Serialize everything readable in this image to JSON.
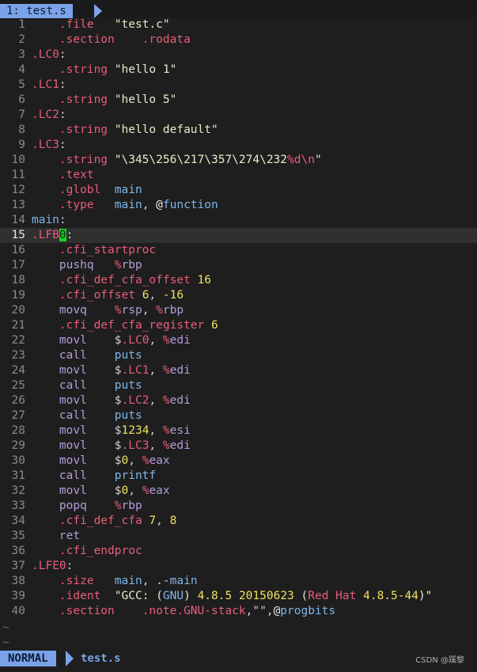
{
  "tab": {
    "label": "1: test.s"
  },
  "cursor": {
    "line": 15,
    "col": 5
  },
  "lines": [
    [
      [
        "t-plain",
        "    "
      ],
      [
        "t-dir",
        ".file"
      ],
      [
        "t-plain",
        "   "
      ],
      [
        "t-str",
        "\"test.c\""
      ]
    ],
    [
      [
        "t-plain",
        "    "
      ],
      [
        "t-dir",
        ".section"
      ],
      [
        "t-plain",
        "    "
      ],
      [
        "t-dir",
        ".rodata"
      ]
    ],
    [
      [
        "t-lbl",
        ".LC0"
      ],
      [
        "t-plain",
        ":"
      ]
    ],
    [
      [
        "t-plain",
        "    "
      ],
      [
        "t-dir",
        ".string"
      ],
      [
        "t-plain",
        " "
      ],
      [
        "t-str",
        "\"hello 1\""
      ]
    ],
    [
      [
        "t-lbl",
        ".LC1"
      ],
      [
        "t-plain",
        ":"
      ]
    ],
    [
      [
        "t-plain",
        "    "
      ],
      [
        "t-dir",
        ".string"
      ],
      [
        "t-plain",
        " "
      ],
      [
        "t-str",
        "\"hello 5\""
      ]
    ],
    [
      [
        "t-lbl",
        ".LC2"
      ],
      [
        "t-plain",
        ":"
      ]
    ],
    [
      [
        "t-plain",
        "    "
      ],
      [
        "t-dir",
        ".string"
      ],
      [
        "t-plain",
        " "
      ],
      [
        "t-str",
        "\"hello default\""
      ]
    ],
    [
      [
        "t-lbl",
        ".LC3"
      ],
      [
        "t-plain",
        ":"
      ]
    ],
    [
      [
        "t-plain",
        "    "
      ],
      [
        "t-dir",
        ".string"
      ],
      [
        "t-plain",
        " "
      ],
      [
        "t-str",
        "\"\\345\\256\\217\\357\\274\\232"
      ],
      [
        "t-esc",
        "%d"
      ],
      [
        "t-esc",
        "\\n"
      ],
      [
        "t-str",
        "\""
      ]
    ],
    [
      [
        "t-plain",
        "    "
      ],
      [
        "t-dir",
        ".text"
      ]
    ],
    [
      [
        "t-plain",
        "    "
      ],
      [
        "t-dir",
        ".globl"
      ],
      [
        "t-plain",
        "  "
      ],
      [
        "t-fn",
        "main"
      ]
    ],
    [
      [
        "t-plain",
        "    "
      ],
      [
        "t-dir",
        ".type"
      ],
      [
        "t-plain",
        "   "
      ],
      [
        "t-fn",
        "main"
      ],
      [
        "t-plain",
        ", "
      ],
      [
        "t-at",
        "@"
      ],
      [
        "t-fn",
        "function"
      ]
    ],
    [
      [
        "t-fn",
        "main"
      ],
      [
        "t-plain",
        ":"
      ]
    ],
    [
      [
        "t-lbl",
        ".LFB"
      ],
      [
        "t-cursor",
        "0"
      ],
      [
        "t-plain",
        ":"
      ]
    ],
    [
      [
        "t-plain",
        "    "
      ],
      [
        "t-dir",
        ".cfi_startproc"
      ]
    ],
    [
      [
        "t-plain",
        "    "
      ],
      [
        "t-ins",
        "pushq"
      ],
      [
        "t-plain",
        "   "
      ],
      [
        "t-reg",
        "%"
      ],
      [
        "t-ins",
        "rbp"
      ]
    ],
    [
      [
        "t-plain",
        "    "
      ],
      [
        "t-dir",
        ".cfi_def_cfa_offset"
      ],
      [
        "t-plain",
        " "
      ],
      [
        "t-num",
        "16"
      ]
    ],
    [
      [
        "t-plain",
        "    "
      ],
      [
        "t-dir",
        ".cfi_offset"
      ],
      [
        "t-plain",
        " "
      ],
      [
        "t-num",
        "6"
      ],
      [
        "t-plain",
        ", "
      ],
      [
        "t-num",
        "-16"
      ]
    ],
    [
      [
        "t-plain",
        "    "
      ],
      [
        "t-ins",
        "movq"
      ],
      [
        "t-plain",
        "    "
      ],
      [
        "t-reg",
        "%"
      ],
      [
        "t-ins",
        "rsp"
      ],
      [
        "t-plain",
        ", "
      ],
      [
        "t-reg",
        "%"
      ],
      [
        "t-ins",
        "rbp"
      ]
    ],
    [
      [
        "t-plain",
        "    "
      ],
      [
        "t-dir",
        ".cfi_def_cfa_register"
      ],
      [
        "t-plain",
        " "
      ],
      [
        "t-num",
        "6"
      ]
    ],
    [
      [
        "t-plain",
        "    "
      ],
      [
        "t-ins",
        "movl"
      ],
      [
        "t-plain",
        "    "
      ],
      [
        "t-plain",
        "$"
      ],
      [
        "t-lbl",
        ".LC0"
      ],
      [
        "t-plain",
        ", "
      ],
      [
        "t-reg",
        "%"
      ],
      [
        "t-ins",
        "edi"
      ]
    ],
    [
      [
        "t-plain",
        "    "
      ],
      [
        "t-ins",
        "call"
      ],
      [
        "t-plain",
        "    "
      ],
      [
        "t-fn",
        "puts"
      ]
    ],
    [
      [
        "t-plain",
        "    "
      ],
      [
        "t-ins",
        "movl"
      ],
      [
        "t-plain",
        "    "
      ],
      [
        "t-plain",
        "$"
      ],
      [
        "t-lbl",
        ".LC1"
      ],
      [
        "t-plain",
        ", "
      ],
      [
        "t-reg",
        "%"
      ],
      [
        "t-ins",
        "edi"
      ]
    ],
    [
      [
        "t-plain",
        "    "
      ],
      [
        "t-ins",
        "call"
      ],
      [
        "t-plain",
        "    "
      ],
      [
        "t-fn",
        "puts"
      ]
    ],
    [
      [
        "t-plain",
        "    "
      ],
      [
        "t-ins",
        "movl"
      ],
      [
        "t-plain",
        "    "
      ],
      [
        "t-plain",
        "$"
      ],
      [
        "t-lbl",
        ".LC2"
      ],
      [
        "t-plain",
        ", "
      ],
      [
        "t-reg",
        "%"
      ],
      [
        "t-ins",
        "edi"
      ]
    ],
    [
      [
        "t-plain",
        "    "
      ],
      [
        "t-ins",
        "call"
      ],
      [
        "t-plain",
        "    "
      ],
      [
        "t-fn",
        "puts"
      ]
    ],
    [
      [
        "t-plain",
        "    "
      ],
      [
        "t-ins",
        "movl"
      ],
      [
        "t-plain",
        "    "
      ],
      [
        "t-plain",
        "$"
      ],
      [
        "t-num",
        "1234"
      ],
      [
        "t-plain",
        ", "
      ],
      [
        "t-reg",
        "%"
      ],
      [
        "t-ins",
        "esi"
      ]
    ],
    [
      [
        "t-plain",
        "    "
      ],
      [
        "t-ins",
        "movl"
      ],
      [
        "t-plain",
        "    "
      ],
      [
        "t-plain",
        "$"
      ],
      [
        "t-lbl",
        ".LC3"
      ],
      [
        "t-plain",
        ", "
      ],
      [
        "t-reg",
        "%"
      ],
      [
        "t-ins",
        "edi"
      ]
    ],
    [
      [
        "t-plain",
        "    "
      ],
      [
        "t-ins",
        "movl"
      ],
      [
        "t-plain",
        "    "
      ],
      [
        "t-plain",
        "$"
      ],
      [
        "t-num",
        "0"
      ],
      [
        "t-plain",
        ", "
      ],
      [
        "t-reg",
        "%"
      ],
      [
        "t-ins",
        "eax"
      ]
    ],
    [
      [
        "t-plain",
        "    "
      ],
      [
        "t-ins",
        "call"
      ],
      [
        "t-plain",
        "    "
      ],
      [
        "t-fn",
        "printf"
      ]
    ],
    [
      [
        "t-plain",
        "    "
      ],
      [
        "t-ins",
        "movl"
      ],
      [
        "t-plain",
        "    "
      ],
      [
        "t-plain",
        "$"
      ],
      [
        "t-num",
        "0"
      ],
      [
        "t-plain",
        ", "
      ],
      [
        "t-reg",
        "%"
      ],
      [
        "t-ins",
        "eax"
      ]
    ],
    [
      [
        "t-plain",
        "    "
      ],
      [
        "t-ins",
        "popq"
      ],
      [
        "t-plain",
        "    "
      ],
      [
        "t-reg",
        "%"
      ],
      [
        "t-ins",
        "rbp"
      ]
    ],
    [
      [
        "t-plain",
        "    "
      ],
      [
        "t-dir",
        ".cfi_def_cfa"
      ],
      [
        "t-plain",
        " "
      ],
      [
        "t-num",
        "7"
      ],
      [
        "t-plain",
        ", "
      ],
      [
        "t-num",
        "8"
      ]
    ],
    [
      [
        "t-plain",
        "    "
      ],
      [
        "t-ins",
        "ret"
      ]
    ],
    [
      [
        "t-plain",
        "    "
      ],
      [
        "t-dir",
        ".cfi_endproc"
      ]
    ],
    [
      [
        "t-lbl",
        ".LFE0"
      ],
      [
        "t-plain",
        ":"
      ]
    ],
    [
      [
        "t-plain",
        "    "
      ],
      [
        "t-dir",
        ".size"
      ],
      [
        "t-plain",
        "   "
      ],
      [
        "t-fn",
        "main"
      ],
      [
        "t-plain",
        ", .-"
      ],
      [
        "t-fn",
        "main"
      ]
    ],
    [
      [
        "t-plain",
        "    "
      ],
      [
        "t-dir",
        ".ident"
      ],
      [
        "t-plain",
        "  "
      ],
      [
        "t-str",
        "\"GCC: ("
      ],
      [
        "t-fn",
        "GNU"
      ],
      [
        "t-str",
        ") "
      ],
      [
        "t-num",
        "4.8.5"
      ],
      [
        "t-str",
        " "
      ],
      [
        "t-num",
        "20150623"
      ],
      [
        "t-str",
        " ("
      ],
      [
        "t-ann",
        "Red Hat"
      ],
      [
        "t-str",
        " "
      ],
      [
        "t-num",
        "4.8.5-44"
      ],
      [
        "t-str",
        ")\""
      ]
    ],
    [
      [
        "t-plain",
        "    "
      ],
      [
        "t-dir",
        ".section"
      ],
      [
        "t-plain",
        "    "
      ],
      [
        "t-dir",
        ".note.GNU-stack"
      ],
      [
        "t-plain",
        ",\"\","
      ],
      [
        "t-at",
        "@"
      ],
      [
        "t-fn",
        "progbits"
      ]
    ]
  ],
  "tildes": [
    "~",
    "~"
  ],
  "status": {
    "mode": "NORMAL",
    "file": "test.s"
  },
  "watermark": "CSDN @蹊黎",
  "colors": {
    "background": "#1e1e1e",
    "accent": "#7aa2e8",
    "directive": "#e85d7a",
    "number": "#f0e060",
    "function": "#7fb6e8",
    "instruction": "#b39ddb",
    "cursor": "#11d61a"
  }
}
